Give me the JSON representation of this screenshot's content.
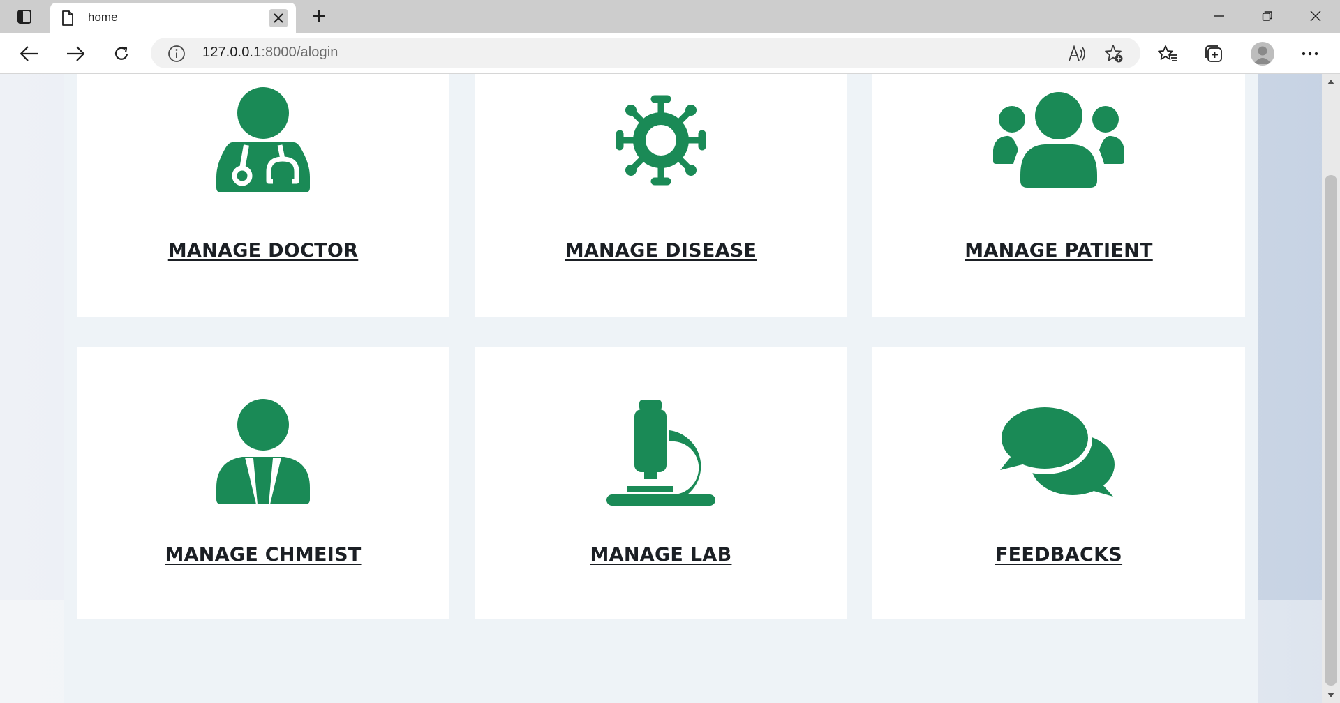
{
  "browser": {
    "tab_title": "home",
    "url_host": "127.0.0.1",
    "url_path": ":8000/alogin"
  },
  "icons": {
    "tab_actions": "tab-actions-icon",
    "favicon": "page-icon",
    "close": "close-icon",
    "new_tab": "plus-icon",
    "back": "back-arrow-icon",
    "forward": "forward-arrow-icon",
    "refresh": "refresh-icon",
    "info": "info-icon",
    "read_aloud": "read-aloud-icon",
    "add_favorite": "add-favorite-icon",
    "favorites": "favorites-icon",
    "collections": "collections-icon",
    "profile": "profile-avatar-icon",
    "more": "more-icon"
  },
  "colors": {
    "accent_green": "#1a8a56",
    "label_text": "#1b1f24",
    "card_bg": "#ffffff",
    "content_bg": "#eef3f7"
  },
  "cards": [
    {
      "label": "MANAGE DOCTOR",
      "icon": "doctor-icon"
    },
    {
      "label": "MANAGE DISEASE",
      "icon": "virus-icon"
    },
    {
      "label": "MANAGE PATIENT",
      "icon": "users-icon"
    },
    {
      "label": "MANAGE CHMEIST",
      "icon": "user-tie-icon"
    },
    {
      "label": "MANAGE LAB",
      "icon": "microscope-icon"
    },
    {
      "label": "FEEDBACKS",
      "icon": "comments-icon"
    }
  ]
}
